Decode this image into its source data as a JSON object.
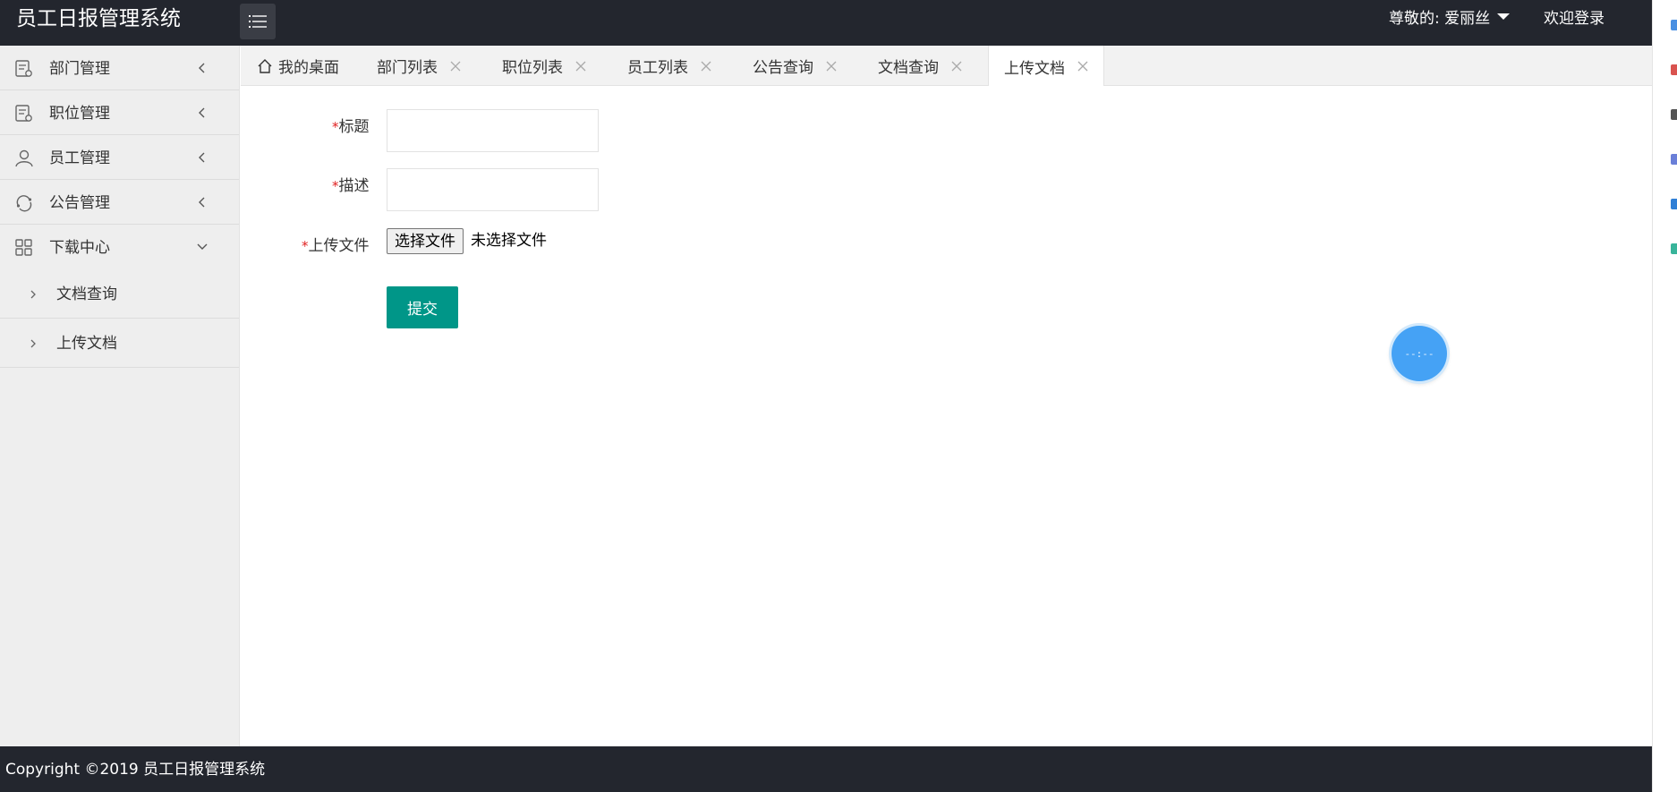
{
  "header": {
    "app_title": "员工日报管理系统",
    "user_greeting": "尊敬的: 爱丽丝",
    "login_label": "欢迎登录"
  },
  "sidebar": {
    "items": [
      {
        "label": "部门管理",
        "icon": "document-icon"
      },
      {
        "label": "职位管理",
        "icon": "document-icon"
      },
      {
        "label": "员工管理",
        "icon": "user-icon"
      },
      {
        "label": "公告管理",
        "icon": "refresh-circle-icon"
      },
      {
        "label": "下载中心",
        "icon": "grid-icon"
      }
    ],
    "subitems": [
      {
        "label": "文档查询"
      },
      {
        "label": "上传文档"
      }
    ]
  },
  "tabs": [
    {
      "label": "我的桌面",
      "icon": "home-icon",
      "closable": false
    },
    {
      "label": "部门列表",
      "closable": true
    },
    {
      "label": "职位列表",
      "closable": true
    },
    {
      "label": "员工列表",
      "closable": true
    },
    {
      "label": "公告查询",
      "closable": true
    },
    {
      "label": "文档查询",
      "closable": true
    },
    {
      "label": "上传文档",
      "closable": true,
      "active": true
    }
  ],
  "form": {
    "required_mark": "*",
    "title_label": "标题",
    "title_value": "",
    "desc_label": "描述",
    "desc_value": "",
    "file_label": "上传文件",
    "file_button": "选择文件",
    "file_status": "未选择文件",
    "submit_label": "提交"
  },
  "clock": {
    "text": "--:--"
  },
  "footer": {
    "copyright": "Copyright ©2019 员工日报管理系统"
  },
  "colors": {
    "header_bg": "#23262e",
    "primary": "#009688",
    "required": "#e02020",
    "clock": "#45a2f5"
  }
}
